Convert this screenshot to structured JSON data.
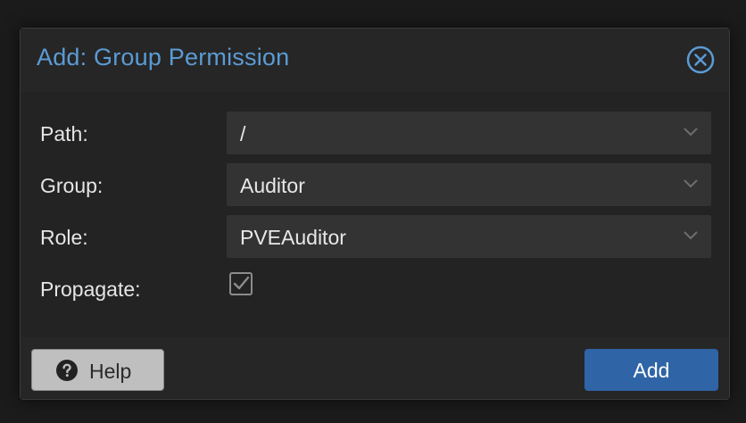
{
  "dialog": {
    "title": "Add: Group Permission",
    "close_icon": "close-icon"
  },
  "form": {
    "path": {
      "label": "Path:",
      "value": "/"
    },
    "group": {
      "label": "Group:",
      "value": "Auditor"
    },
    "role": {
      "label": "Role:",
      "value": "PVEAuditor"
    },
    "propagate": {
      "label": "Propagate:",
      "checked": true
    }
  },
  "footer": {
    "help_label": "Help",
    "help_icon": "question-circle-icon",
    "add_label": "Add"
  },
  "colors": {
    "title": "#5b9bd5",
    "primary_button": "#2f64a6",
    "help_button": "#bfbfbf",
    "field_background": "#333333"
  }
}
